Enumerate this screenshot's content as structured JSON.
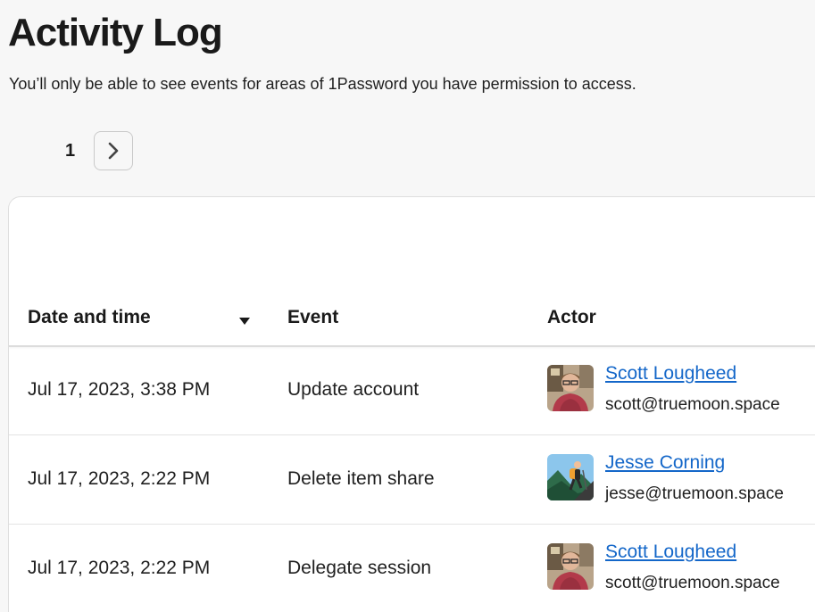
{
  "header": {
    "title": "Activity Log",
    "subtitle": "You’ll only be able to see events for areas of 1Password you have permission to access."
  },
  "pagination": {
    "current_page": "1",
    "next_icon": "chevron-right-icon"
  },
  "table": {
    "columns": {
      "date": "Date and time",
      "event": "Event",
      "actor": "Actor"
    },
    "sort_icon": "caret-down-icon",
    "rows": [
      {
        "date": "Jul 17, 2023, 3:38 PM",
        "event": "Update account",
        "actor_name": "Scott Lougheed",
        "actor_email": "scott@truemoon.space"
      },
      {
        "date": "Jul 17, 2023, 2:22 PM",
        "event": "Delete item share",
        "actor_name": "Jesse Corning",
        "actor_email": "jesse@truemoon.space"
      },
      {
        "date": "Jul 17, 2023, 2:22 PM",
        "event": "Delegate session",
        "actor_name": "Scott Lougheed",
        "actor_email": "scott@truemoon.space"
      }
    ]
  },
  "colors": {
    "link": "#1467c9",
    "background": "#f7f7f7",
    "card": "#ffffff"
  }
}
